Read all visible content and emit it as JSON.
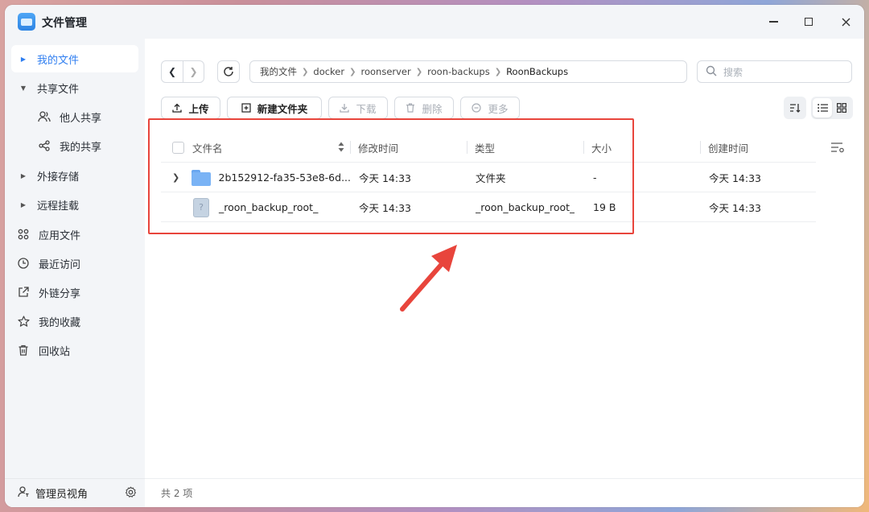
{
  "app": {
    "title": "文件管理"
  },
  "sidebar": {
    "items": [
      {
        "label": "我的文件",
        "icon": "caret-right-icon",
        "active": true
      },
      {
        "label": "共享文件",
        "icon": "caret-down-icon"
      },
      {
        "label": "他人共享",
        "icon": "users-icon"
      },
      {
        "label": "我的共享",
        "icon": "share-icon"
      },
      {
        "label": "外接存储",
        "icon": "caret-right-icon"
      },
      {
        "label": "远程挂载",
        "icon": "caret-right-icon"
      },
      {
        "label": "应用文件",
        "icon": "apps-icon"
      },
      {
        "label": "最近访问",
        "icon": "clock-icon"
      },
      {
        "label": "外链分享",
        "icon": "external-link-icon"
      },
      {
        "label": "我的收藏",
        "icon": "star-icon"
      },
      {
        "label": "回收站",
        "icon": "trash-icon"
      }
    ],
    "admin_label": "管理员视角"
  },
  "breadcrumb": [
    "我的文件",
    "docker",
    "roonserver",
    "roon-backups",
    "RoonBackups"
  ],
  "search": {
    "placeholder": "搜索"
  },
  "toolbar": {
    "upload": "上传",
    "new_folder": "新建文件夹",
    "download": "下载",
    "delete": "删除",
    "more": "更多"
  },
  "table": {
    "headers": {
      "name": "文件名",
      "modified": "修改时间",
      "type": "类型",
      "size": "大小",
      "created": "创建时间"
    },
    "rows": [
      {
        "name": "2b152912-fa35-53e8-6d...",
        "modified": "今天 14:33",
        "type": "文件夹",
        "size": "-",
        "created": "今天 14:33",
        "kind": "folder"
      },
      {
        "name": "_roon_backup_root_",
        "modified": "今天 14:33",
        "type": "_roon_backup_root_",
        "size": "19 B",
        "created": "今天 14:33",
        "kind": "file"
      }
    ]
  },
  "status": {
    "count_text": "共 2 项"
  },
  "colors": {
    "accent": "#2f7ef0",
    "highlight": "#e8453c"
  }
}
